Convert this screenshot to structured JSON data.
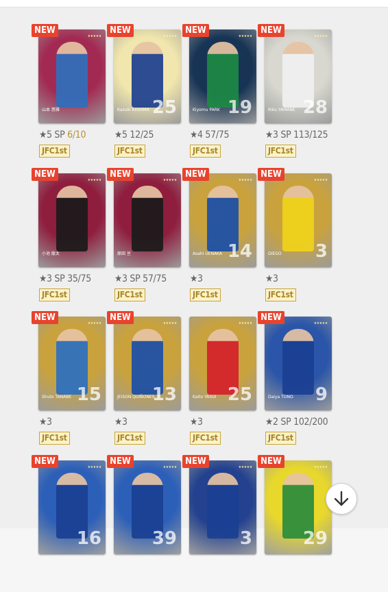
{
  "new_badge": "NEW",
  "cards": [
    {
      "new": "NEW",
      "stars": "★5",
      "sp": "SP",
      "count": "6",
      "total": "/10",
      "badge": "JFC1st",
      "name": "山本 悠雅",
      "num": "",
      "bg": "#a22a52",
      "accent": "#2f6fbd"
    },
    {
      "new": "NEW",
      "stars": "★5",
      "sp": "",
      "count": "12/25",
      "total": "",
      "badge": "JFC1st",
      "name": "Kazuki KISHIMA",
      "num": "25",
      "bg": "#f1e6ad",
      "accent": "#1d3f8f"
    },
    {
      "new": "NEW",
      "stars": "★4",
      "sp": "",
      "count": "57/75",
      "total": "",
      "badge": "JFC1st",
      "name": "Kiyomu PARK",
      "num": "19",
      "bg": "#173455",
      "accent": "#1d8a44"
    },
    {
      "new": "NEW",
      "stars": "★3",
      "sp": "SP",
      "count": "113/125",
      "total": "",
      "badge": "JFC1st",
      "name": "Riku YAMANE",
      "num": "28",
      "bg": "#d8d8d0",
      "accent": "#f0f0f0"
    },
    {
      "new": "NEW",
      "stars": "★3",
      "sp": "SP",
      "count": "35/75",
      "total": "",
      "badge": "JFC1st",
      "name": "小池 龍太",
      "num": "",
      "bg": "#8f1d3e",
      "accent": "#1a1a1a"
    },
    {
      "new": "NEW",
      "stars": "★3",
      "sp": "SP",
      "count": "57/75",
      "total": "",
      "badge": "JFC1st",
      "name": "原田 亘",
      "num": "",
      "bg": "#8f1d3e",
      "accent": "#1a1a1a"
    },
    {
      "new": "NEW",
      "stars": "★3",
      "sp": "",
      "count": "",
      "total": "",
      "badge": "JFC1st",
      "name": "Asahi UENAKA",
      "num": "14",
      "bg": "#c9a23d",
      "accent": "#1a4ea8"
    },
    {
      "new": "NEW",
      "stars": "★3",
      "sp": "",
      "count": "",
      "total": "",
      "badge": "JFC1st",
      "name": "DIEGO",
      "num": "3",
      "bg": "#c9a23d",
      "accent": "#f0d31a"
    },
    {
      "new": "NEW",
      "stars": "★3",
      "sp": "",
      "count": "",
      "total": "",
      "badge": "JFC1st",
      "name": "Shuto TANABE",
      "num": "15",
      "bg": "#c9a23d",
      "accent": "#2b6fc0"
    },
    {
      "new": "NEW",
      "stars": "★3",
      "sp": "",
      "count": "",
      "total": "",
      "badge": "JFC1st",
      "name": "JEISON QUIÑONES",
      "num": "13",
      "bg": "#c9a23d",
      "accent": "#1a4ea8"
    },
    {
      "new": "",
      "stars": "★3",
      "sp": "",
      "count": "",
      "total": "",
      "badge": "JFC1st",
      "name": "Kaito YASUI",
      "num": "25",
      "bg": "#c9a23d",
      "accent": "#d4202a"
    },
    {
      "new": "NEW",
      "stars": "★2",
      "sp": "SP",
      "count": "102/200",
      "total": "",
      "badge": "JFC1st",
      "name": "Daiya TONO",
      "num": "9",
      "bg": "#2a55a8",
      "accent": "#1a3f92"
    },
    {
      "new": "NEW",
      "stars": "",
      "sp": "",
      "count": "",
      "total": "",
      "badge": "",
      "name": "",
      "num": "16",
      "bg": "#2c5fb8",
      "accent": "#1a3f92"
    },
    {
      "new": "NEW",
      "stars": "",
      "sp": "",
      "count": "",
      "total": "",
      "badge": "",
      "name": "",
      "num": "39",
      "bg": "#2c5fb8",
      "accent": "#1a3f92"
    },
    {
      "new": "NEW",
      "stars": "",
      "sp": "",
      "count": "",
      "total": "",
      "badge": "",
      "name": "",
      "num": "3",
      "bg": "#23418e",
      "accent": "#1a3f92"
    },
    {
      "new": "NEW",
      "stars": "",
      "sp": "",
      "count": "",
      "total": "",
      "badge": "",
      "name": "",
      "num": "29",
      "bg": "#e8d82c",
      "accent": "#2a8c3c"
    }
  ],
  "scroll_button": {
    "icon": "arrow-down-icon"
  }
}
